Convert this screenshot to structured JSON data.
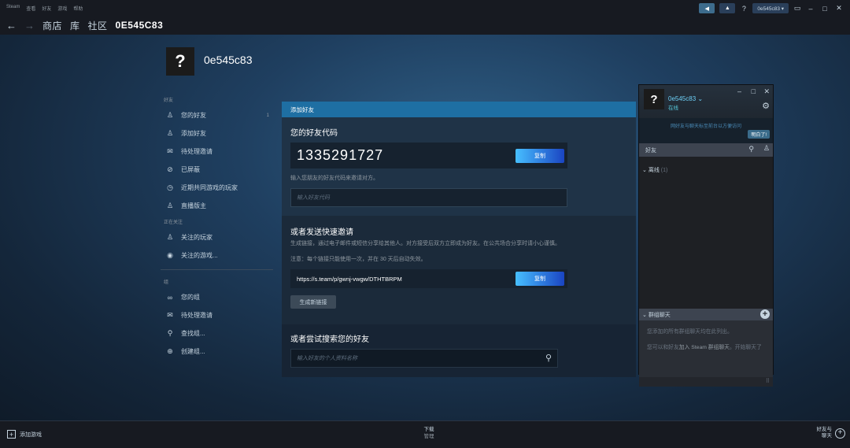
{
  "titlebar": {
    "menu": [
      "Steam",
      "查看",
      "好友",
      "游戏",
      "帮助"
    ],
    "account": "0e545c83 ▾",
    "help": "?"
  },
  "nav": {
    "back": "←",
    "forward": "→",
    "store": "商店",
    "library": "库",
    "community": "社区",
    "username": "0E545C83"
  },
  "profile": {
    "avatar": "?",
    "name": "0e545c83"
  },
  "sidebar": {
    "friends_section": "好友",
    "friends_items": [
      {
        "label": "您的好友",
        "icon": "person-icon",
        "count": "1"
      },
      {
        "label": "添加好友",
        "icon": "add-person-icon"
      },
      {
        "label": "待处理邀请",
        "icon": "mail-icon"
      },
      {
        "label": "已屏蔽",
        "icon": "block-icon"
      },
      {
        "label": "近期共同游戏的玩家",
        "icon": "clock-icon"
      },
      {
        "label": "直播版主",
        "icon": "broadcast-icon"
      }
    ],
    "following_section": "正在关注",
    "following_items": [
      {
        "label": "关注的玩家",
        "icon": "add-person-icon"
      },
      {
        "label": "关注的游戏...",
        "icon": "eye-icon"
      }
    ],
    "groups_section": "组",
    "group_items": [
      {
        "label": "您的组",
        "icon": "group-icon"
      },
      {
        "label": "待处理邀请",
        "icon": "mail-icon"
      },
      {
        "label": "查找组...",
        "icon": "search-icon"
      },
      {
        "label": "创建组...",
        "icon": "plus-circle-icon"
      }
    ]
  },
  "add_friend": {
    "header": "添加好友",
    "code_title": "您的好友代码",
    "code": "1335291727",
    "copy": "复制",
    "hint": "输入您朋友的好友代码来邀请对方。",
    "code_placeholder": "输入好友代码",
    "quick_title": "或者发送快速邀请",
    "quick_desc": "生成链接，通过电子邮件或短信分享给其他人。对方接受后双方立即成为好友。在公共场合分享时请小心谨慎。",
    "quick_note": "注意：每个链接只能使用一次，并在 30 天后自动失效。",
    "link": "https://s.team/p/gwnj-vwgw/DTHTBRPM",
    "copy2": "复制",
    "new_link": "生成新链接",
    "search_title": "或者尝试搜索您的好友",
    "search_placeholder": "输入好友的个人资料名称"
  },
  "friends_window": {
    "avatar": "?",
    "name": "0e545c83",
    "name_caret": "⌄",
    "status": "在线",
    "banner": "网好友与聊天标至前台以方便访问",
    "got_it": "明白了!",
    "search_label": "好友",
    "offline_group": "离线",
    "offline_count": "(1)",
    "group_chat": "群组聊天",
    "chat_msg1": "您添加的所有群组聊天均在此列出。",
    "chat_msg2_pre": "您可以和好友",
    "chat_msg2_link": "加入 Steam 群组聊天",
    "chat_msg2_post": "。开始聊天了"
  },
  "bottombar": {
    "add_game": "添加游戏",
    "download": "下载",
    "download_sub": "管理",
    "friends_chat_1": "好友与",
    "friends_chat_2": "聊天"
  }
}
